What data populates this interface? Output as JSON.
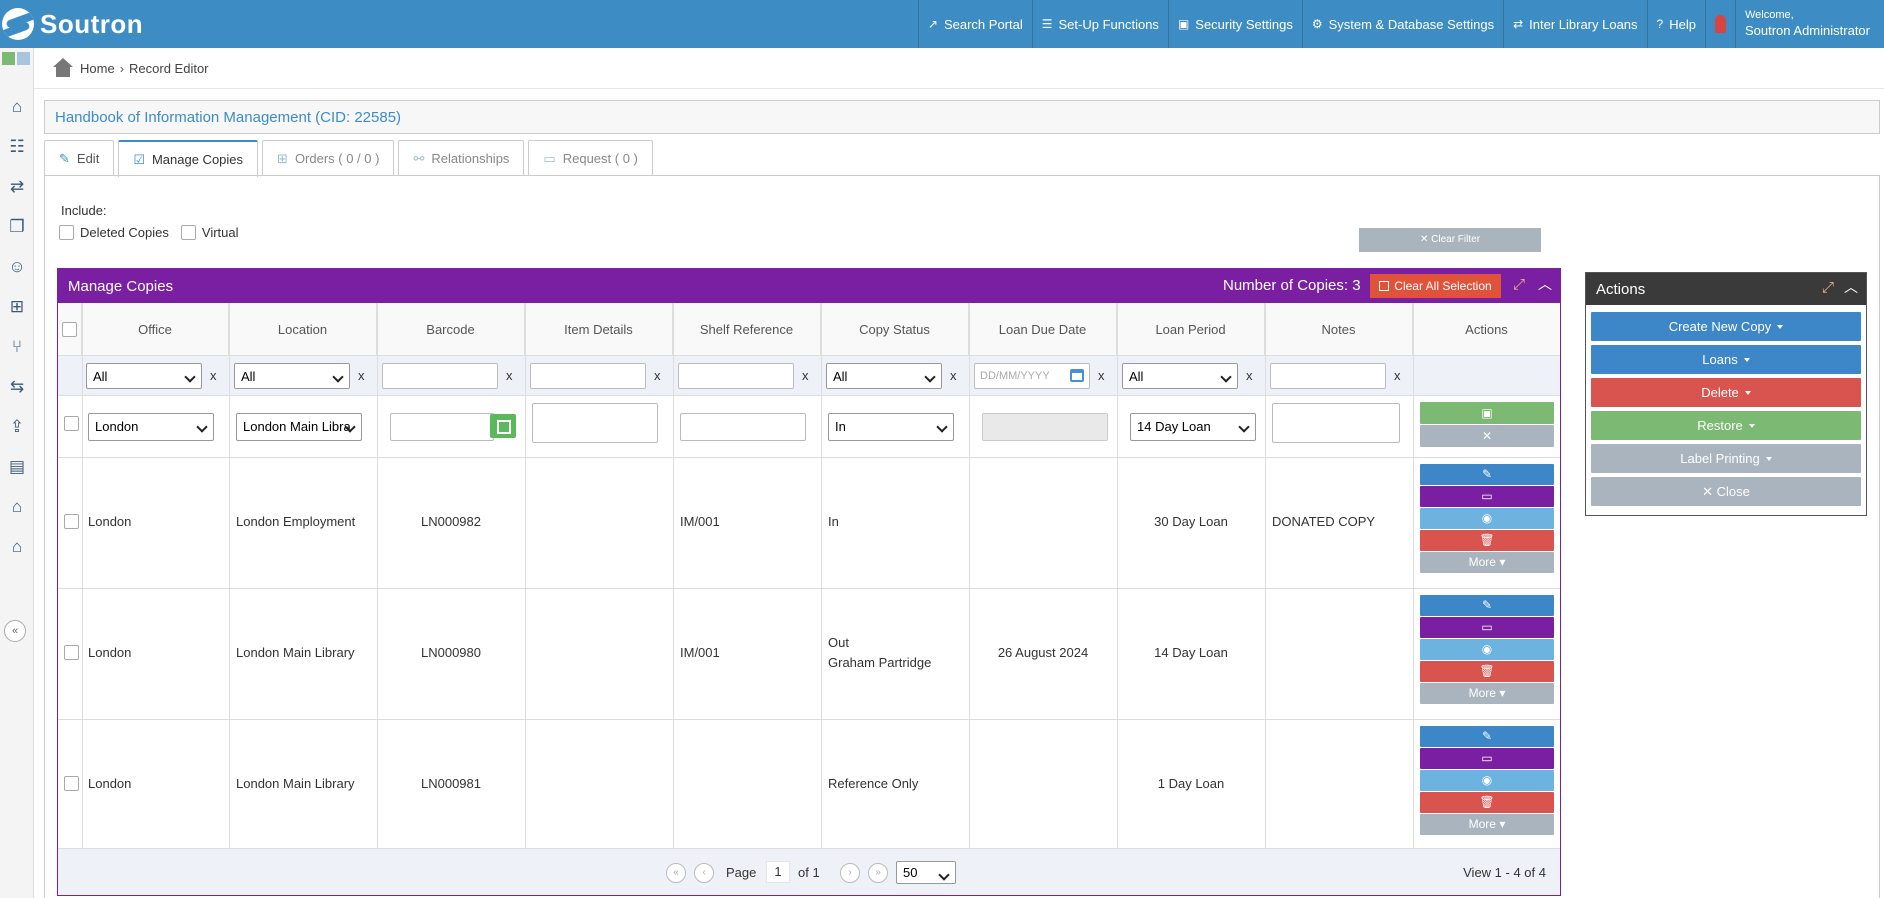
{
  "app": {
    "logo_text": "Soutron",
    "nav": [
      {
        "label": "Search Portal",
        "icon": "external-link-icon"
      },
      {
        "label": "Set-Up Functions",
        "icon": "sliders-icon"
      },
      {
        "label": "Security Settings",
        "icon": "lock-icon"
      },
      {
        "label": "System & Database Settings",
        "icon": "gear-icon"
      },
      {
        "label": "Inter Library Loans",
        "icon": "exchange-icon"
      },
      {
        "label": "Help",
        "icon": "question-icon"
      }
    ],
    "welcome": "Welcome,",
    "user": "Soutron Administrator"
  },
  "breadcrumb": {
    "home": "Home",
    "current": "Record Editor"
  },
  "record": {
    "title": "Handbook of Information Management (CID: 22585)"
  },
  "tabs": [
    {
      "label": "Edit",
      "icon": "edit-icon"
    },
    {
      "label": "Manage Copies",
      "icon": "list-check-icon"
    },
    {
      "label": "Orders ( 0 / 0 )",
      "icon": "cart-icon"
    },
    {
      "label": "Relationships",
      "icon": "hierarchy-icon"
    },
    {
      "label": "Request ( 0 )",
      "icon": "ticket-icon"
    }
  ],
  "include": {
    "label": "Include:",
    "deleted": "Deleted Copies",
    "virtual": "Virtual",
    "clear_filter": "✕ Clear Filter"
  },
  "grid": {
    "title": "Manage Copies",
    "count": "Number of Copies: 3",
    "clear_all": "Clear All Selection",
    "columns": [
      "Office",
      "Location",
      "Barcode",
      "Item Details",
      "Shelf Reference",
      "Copy Status",
      "Loan Due Date",
      "Loan Period",
      "Notes",
      "Actions"
    ],
    "filters": {
      "all": "All",
      "x": "x",
      "date_placeholder": "DD/MM/YYYY"
    },
    "new_row": {
      "office": "London",
      "location": "London Main Libra",
      "status": "In",
      "period": "14 Day Loan"
    },
    "rows": [
      {
        "office": "London",
        "location": "London Employment",
        "barcode": "LN000982",
        "details": "",
        "shelf": "IM/001",
        "status": "In",
        "status2": "",
        "due": "",
        "period": "30 Day Loan",
        "notes": "DONATED COPY"
      },
      {
        "office": "London",
        "location": "London Main Library",
        "barcode": "LN000980",
        "details": "",
        "shelf": "IM/001",
        "status": "Out",
        "status2": "Graham Partridge",
        "due": "26 August 2024",
        "period": "14 Day Loan",
        "notes": ""
      },
      {
        "office": "London",
        "location": "London Main Library",
        "barcode": "LN000981",
        "details": "",
        "shelf": "",
        "status": "Reference Only",
        "status2": "",
        "due": "",
        "period": "1 Day Loan",
        "notes": ""
      }
    ],
    "more": "More",
    "pager": {
      "page_label": "Page",
      "page": "1",
      "of": "of 1",
      "page_size": "50",
      "view": "View 1 - 4 of 4"
    }
  },
  "actions": {
    "title": "Actions",
    "buttons": [
      {
        "label": "Create New Copy",
        "color": "#3d87c9",
        "caret": true
      },
      {
        "label": "Loans",
        "color": "#3d87c9",
        "caret": true
      },
      {
        "label": "Delete",
        "color": "#d9534f",
        "caret": true
      },
      {
        "label": "Restore",
        "color": "#7cb972",
        "caret": true
      },
      {
        "label": "Label Printing",
        "color": "#a9b4be",
        "caret": true
      },
      {
        "label": "✕ Close",
        "color": "#a9b4be",
        "caret": false
      }
    ]
  },
  "colors": {
    "brand": "#3d8dc4",
    "grid_header": "#7b1fa2",
    "danger": "#d9534f",
    "success": "#7cb972",
    "muted": "#a9b4be"
  }
}
